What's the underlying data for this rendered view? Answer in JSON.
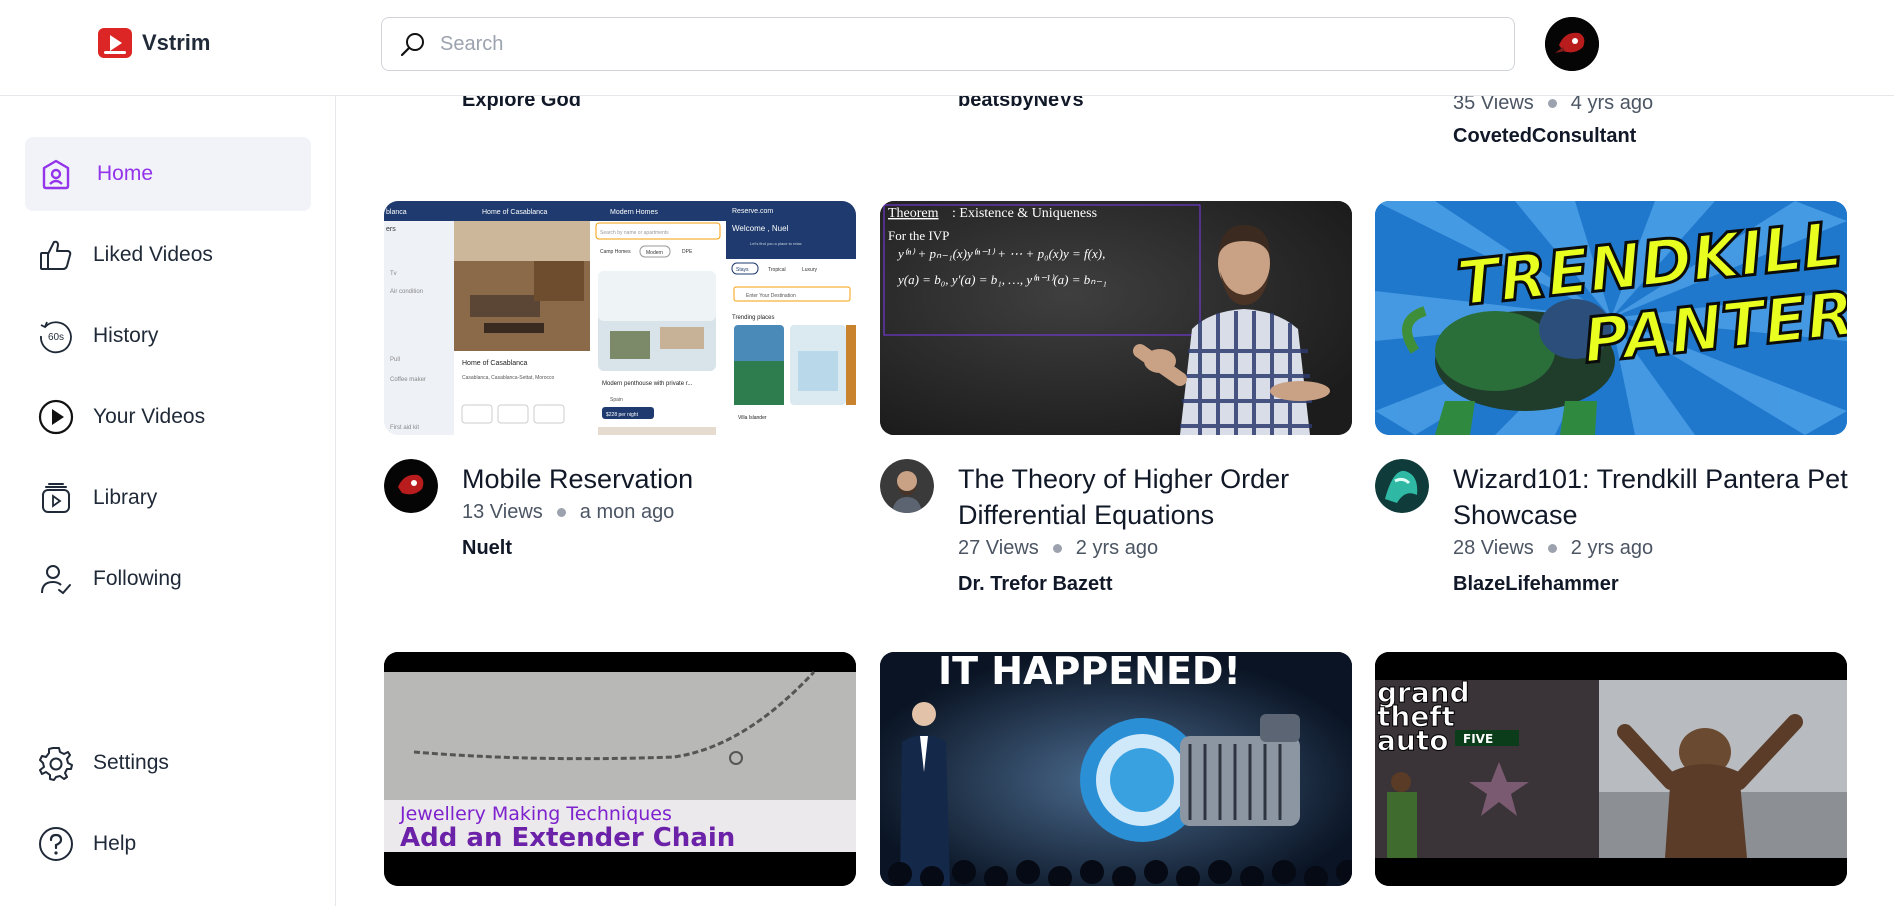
{
  "brand": {
    "name": "Vstrim",
    "accent": "#dc2626"
  },
  "search": {
    "placeholder": "Search"
  },
  "sidebar": {
    "items": [
      {
        "label": "Home",
        "icon": "home-icon",
        "active": true
      },
      {
        "label": "Liked Videos",
        "icon": "thumbs-up-icon"
      },
      {
        "label": "History",
        "icon": "history-60s-icon"
      },
      {
        "label": "Your Videos",
        "icon": "play-circle-icon"
      },
      {
        "label": "Library",
        "icon": "library-icon"
      },
      {
        "label": "Following",
        "icon": "user-check-icon"
      }
    ],
    "bottom": [
      {
        "label": "Settings",
        "icon": "gear-icon"
      },
      {
        "label": "Help",
        "icon": "help-circle-icon"
      }
    ],
    "active_color": "#9333ea"
  },
  "top_row": [
    {
      "channel": "Explore God"
    },
    {
      "channel": "beatsbyNeVs"
    },
    {
      "views": "35 Views",
      "age": "4 yrs ago",
      "channel": "CovetedConsultant"
    }
  ],
  "videos": [
    {
      "title": "Mobile Reservation",
      "views": "13 Views",
      "age": "a mon ago",
      "channel": "Nuelt"
    },
    {
      "title": "The Theory of Higher Order Differential Equations",
      "views": "27 Views",
      "age": "2 yrs ago",
      "channel": "Dr. Trefor Bazett"
    },
    {
      "title": "Wizard101: Trendkill Pantera Pet Showcase",
      "views": "28 Views",
      "age": "2 yrs ago",
      "channel": "BlazeLifehammer"
    }
  ],
  "thumb_text": {
    "math": {
      "theorem": "Theorem",
      "theorem_rest": ": Existence & Uniqueness",
      "ivp": "For the IVP",
      "eq1": "y⁽ⁿ⁾ + pₙ₋₁(x)y⁽ⁿ⁻¹⁾ + ⋯ + p₀(x)y = f(x),",
      "eq2": "y(a) = b₀, y′(a) = b₁, …, y⁽ⁿ⁻¹⁾(a) = bₙ₋₁"
    },
    "trendkill": {
      "line1": "TRENDKILL",
      "line2": "PANTERA"
    },
    "jewellery": {
      "line1": "Jewellery Making Techniques",
      "line2": "Add an Extender Chain"
    },
    "happened": "IT HAPPENED!",
    "gta": {
      "line1": "grand",
      "line2": "theft",
      "line3": "auto",
      "badge": "FIVE"
    },
    "app": {
      "screen1_title": "Home of Casablanca",
      "screen1_caption": "Home of Casablanca",
      "screen1_loc": "Casablanca, Casablanca-Settat, Morocco",
      "screen2_title": "Modern Homes",
      "screen2_search": "Search by name or apartments",
      "screen2_tab1": "Camp Homes",
      "screen2_tab2": "Modern",
      "screen2_tab3": "DPE",
      "screen2_caption": "Modern penthouse with private r...",
      "screen2_loc": "Spain",
      "screen2_price": "$228 per night",
      "screen3_title": "Reserve.com",
      "screen3_welcome": "Welcome , Nuel",
      "screen3_sub": "Let's find you a place to relax",
      "screen3_tab1": "Stays",
      "screen3_tab2": "Tropical",
      "screen3_tab3": "Luxury",
      "screen3_input": "Enter Your Destination",
      "screen3_trending": "Trending places",
      "screen3_place": "Villa Islander"
    }
  }
}
